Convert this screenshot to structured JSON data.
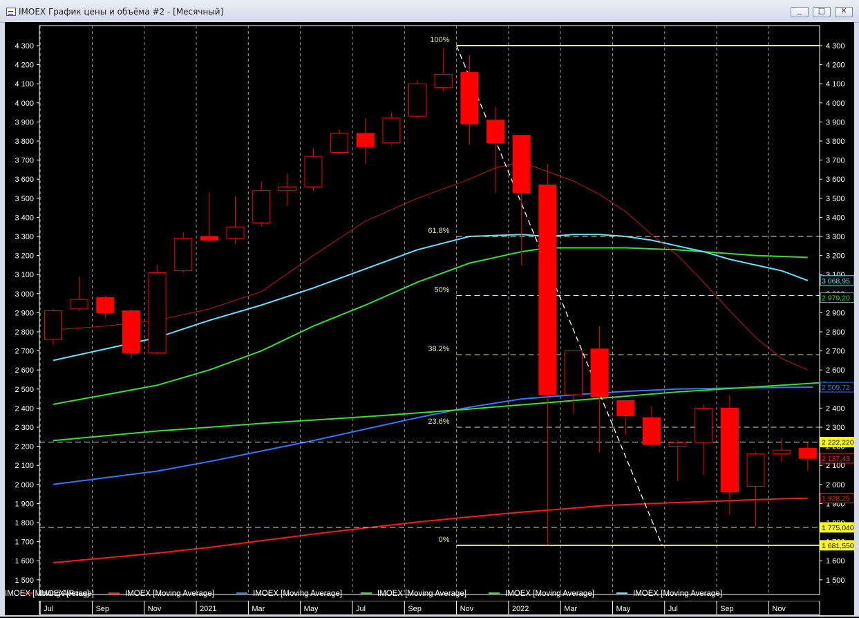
{
  "window": {
    "title": "IMOEX График цены и объёма #2 - [Месячный]",
    "minimize_glyph": "_",
    "maximize_glyph": "□",
    "close_glyph": "✕",
    "icon": "chart-window-icon"
  },
  "chart_data": {
    "type": "candlestick",
    "title": "",
    "xlabel": "",
    "ylabel": "",
    "ylim": [
      1480,
      4380
    ],
    "y_ticks": [
      1500,
      1600,
      1700,
      1800,
      1900,
      2000,
      2100,
      2200,
      2300,
      2400,
      2500,
      2600,
      2700,
      2800,
      2900,
      3000,
      3100,
      3200,
      3300,
      3400,
      3500,
      3600,
      3700,
      3800,
      3900,
      4000,
      4100,
      4200,
      4300
    ],
    "y_tick_labels": [
      "1 500",
      "1 600",
      "1 700",
      "1 800",
      "1 900",
      "2 000",
      "2 100",
      "2 200",
      "2 300",
      "2 400",
      "2 500",
      "2 600",
      "2 700",
      "2 800",
      "2 900",
      "3 000",
      "3 100",
      "3 200",
      "3 300",
      "3 400",
      "3 500",
      "3 600",
      "3 700",
      "3 800",
      "3 900",
      "4 000",
      "4 100",
      "4 200",
      "4 300"
    ],
    "x_labels": [
      "Jul",
      "Sep",
      "Nov",
      "2021",
      "Mar",
      "May",
      "Jul",
      "Sep",
      "Nov",
      "2022",
      "Mar",
      "May",
      "Jul",
      "Sep",
      "Nov"
    ],
    "x_label_months": [
      1,
      3,
      5,
      7,
      9,
      11,
      13,
      15,
      17,
      19,
      21,
      23,
      25,
      27,
      29
    ],
    "grid": true,
    "colors": {
      "up": "#ff0000",
      "down": "#ff0000",
      "grid": "#9a9a9a",
      "axis_text": "#ffffff",
      "fib": "#e8e8a8"
    },
    "candles": [
      {
        "m": 0,
        "o": 2760,
        "h": 2920,
        "l": 2730,
        "c": 2910
      },
      {
        "m": 1,
        "o": 2920,
        "h": 3090,
        "l": 2910,
        "c": 2970
      },
      {
        "m": 2,
        "o": 2980,
        "h": 2990,
        "l": 2870,
        "c": 2900
      },
      {
        "m": 3,
        "o": 2910,
        "h": 2920,
        "l": 2660,
        "c": 2690
      },
      {
        "m": 4,
        "o": 2690,
        "h": 3150,
        "l": 2680,
        "c": 3110
      },
      {
        "m": 5,
        "o": 3120,
        "h": 3320,
        "l": 3110,
        "c": 3290
      },
      {
        "m": 6,
        "o": 3300,
        "h": 3530,
        "l": 3270,
        "c": 3280
      },
      {
        "m": 7,
        "o": 3290,
        "h": 3510,
        "l": 3260,
        "c": 3350
      },
      {
        "m": 8,
        "o": 3370,
        "h": 3590,
        "l": 3350,
        "c": 3540
      },
      {
        "m": 9,
        "o": 3540,
        "h": 3630,
        "l": 3460,
        "c": 3560
      },
      {
        "m": 10,
        "o": 3560,
        "h": 3760,
        "l": 3540,
        "c": 3720
      },
      {
        "m": 11,
        "o": 3740,
        "h": 3860,
        "l": 3730,
        "c": 3840
      },
      {
        "m": 12,
        "o": 3840,
        "h": 3920,
        "l": 3680,
        "c": 3770
      },
      {
        "m": 13,
        "o": 3790,
        "h": 3950,
        "l": 3780,
        "c": 3920
      },
      {
        "m": 14,
        "o": 3930,
        "h": 4120,
        "l": 3920,
        "c": 4100
      },
      {
        "m": 15,
        "o": 4080,
        "h": 4290,
        "l": 4060,
        "c": 4150
      },
      {
        "m": 16,
        "o": 4160,
        "h": 4250,
        "l": 3780,
        "c": 3890
      },
      {
        "m": 17,
        "o": 3910,
        "h": 3980,
        "l": 3530,
        "c": 3790
      },
      {
        "m": 18,
        "o": 3830,
        "h": 3830,
        "l": 3150,
        "c": 3530
      },
      {
        "m": 19,
        "o": 3570,
        "h": 3680,
        "l": 1681,
        "c": 2470
      },
      {
        "m": 20,
        "o": 2470,
        "h": 2700,
        "l": 2370,
        "c": 2700
      },
      {
        "m": 21,
        "o": 2710,
        "h": 2830,
        "l": 2170,
        "c": 2460
      },
      {
        "m": 22,
        "o": 2440,
        "h": 2440,
        "l": 2260,
        "c": 2360
      },
      {
        "m": 23,
        "o": 2350,
        "h": 2410,
        "l": 2190,
        "c": 2210
      },
      {
        "m": 24,
        "o": 2200,
        "h": 2230,
        "l": 2020,
        "c": 2220
      },
      {
        "m": 25,
        "o": 2220,
        "h": 2420,
        "l": 2050,
        "c": 2400
      },
      {
        "m": 26,
        "o": 2400,
        "h": 2470,
        "l": 1840,
        "c": 1960
      },
      {
        "m": 27,
        "o": 1990,
        "h": 2170,
        "l": 1780,
        "c": 2160
      },
      {
        "m": 28,
        "o": 2160,
        "h": 2240,
        "l": 2120,
        "c": 2180
      },
      {
        "m": 29,
        "o": 2190,
        "h": 2220,
        "l": 2070,
        "c": 2137
      }
    ],
    "series": [
      {
        "name": "IMOEX [Price]",
        "color": "#ff0000"
      },
      {
        "name": "IMOEX [Moving Average]",
        "color": "#ff1a1a",
        "x": [
          0,
          2,
          4,
          6,
          8,
          10,
          12,
          14,
          16,
          18,
          19.5,
          21,
          23,
          25,
          26,
          27,
          28,
          29
        ],
        "values": [
          1590,
          1615,
          1640,
          1670,
          1705,
          1740,
          1772,
          1803,
          1830,
          1855,
          1870,
          1888,
          1900,
          1910,
          1915,
          1920,
          1925,
          1928
        ]
      },
      {
        "name": "IMOEX [Moving Average]",
        "color": "#3377ff",
        "x": [
          0,
          2,
          4,
          6,
          8,
          10,
          12,
          14,
          16,
          18,
          20,
          22,
          24,
          26,
          28,
          29.2
        ],
        "values": [
          2000,
          2035,
          2070,
          2120,
          2175,
          2230,
          2290,
          2350,
          2405,
          2448,
          2470,
          2488,
          2500,
          2505,
          2509,
          2510
        ]
      },
      {
        "name": "IMOEX [Moving Average]",
        "color": "#33e033",
        "x": [
          0,
          4,
          8,
          12,
          16,
          20,
          24,
          28,
          29.7
        ],
        "values": [
          2230,
          2280,
          2320,
          2355,
          2395,
          2440,
          2485,
          2520,
          2535
        ]
      },
      {
        "name": "IMOEX [Moving Average]",
        "color": "#33e033",
        "x": [
          0,
          2,
          4,
          6,
          8,
          10,
          12,
          14,
          16,
          18,
          19,
          20,
          21,
          22,
          23,
          24,
          25,
          26,
          27,
          28,
          29
        ],
        "values": [
          2420,
          2470,
          2520,
          2600,
          2700,
          2830,
          2940,
          3060,
          3160,
          3220,
          3240,
          3240,
          3240,
          3240,
          3235,
          3230,
          3220,
          3210,
          3200,
          3195,
          3190
        ]
      },
      {
        "name": "IMOEX [Moving Average]",
        "color": "#66e0ff",
        "x": [
          0,
          2,
          4,
          6,
          8,
          10,
          12,
          14,
          16,
          18,
          19,
          20,
          21,
          22,
          23,
          24,
          25,
          26,
          27,
          28,
          29
        ],
        "values": [
          2650,
          2710,
          2770,
          2860,
          2940,
          3030,
          3130,
          3230,
          3300,
          3310,
          3300,
          3310,
          3310,
          3300,
          3280,
          3250,
          3220,
          3180,
          3150,
          3120,
          3069
        ]
      },
      {
        "name": "IMOEX [Moving Average]",
        "color": "#c01818",
        "x": [
          0,
          2,
          4,
          6,
          8,
          10,
          12,
          14,
          16,
          17,
          18,
          19,
          20,
          21,
          22,
          23,
          24,
          25,
          26,
          27,
          28,
          29
        ],
        "values": [
          2810,
          2830,
          2860,
          2920,
          3010,
          3200,
          3380,
          3500,
          3600,
          3660,
          3690,
          3640,
          3590,
          3520,
          3430,
          3310,
          3200,
          3060,
          2910,
          2770,
          2660,
          2600
        ]
      }
    ],
    "fibonacci": {
      "levels": [
        {
          "label": "100%",
          "value": 4300
        },
        {
          "label": "61.8%",
          "value": 3300
        },
        {
          "label": "50%",
          "value": 2990
        },
        {
          "label": "38.2%",
          "value": 2680
        },
        {
          "label": "23.6%",
          "value": 2300
        },
        {
          "label": "0%",
          "value": 1681
        }
      ],
      "start_month": 15.5,
      "trend_from": [
        15.5,
        4300
      ],
      "trend_to": [
        23.4,
        1681
      ]
    },
    "dashed_levels": [
      {
        "value": 2222,
        "color": "#e8e8a8",
        "start_month": -1.5
      },
      {
        "value": 1775,
        "color": "#e8e8a8",
        "start_month": -1.5
      }
    ],
    "solid_levels": [
      {
        "value": 4300,
        "color": "#e8e8a0",
        "start_month": 15.5
      },
      {
        "value": 1681,
        "color": "#e8e8a0",
        "start_month": 15.5
      }
    ],
    "right_labels": [
      {
        "text": "3 068,95",
        "value": 3069,
        "bg": "#000000",
        "fg": "#66e0ff",
        "border": "#66e0ff"
      },
      {
        "text": "2 979,20",
        "value": 2979,
        "bg": "#000000",
        "fg": "#33e033",
        "border": "#33e033"
      },
      {
        "text": "2 509,72",
        "value": 2510,
        "bg": "#000000",
        "fg": "#3377ff",
        "border": "#3377ff"
      },
      {
        "text": "2 222,220",
        "value": 2222,
        "bg": "#ffff00",
        "fg": "#000000",
        "border": "#ffff00"
      },
      {
        "text": "2 137,43",
        "value": 2137,
        "bg": "#000000",
        "fg": "#ff2020",
        "border": "#ff2020"
      },
      {
        "text": "1 928,25",
        "value": 1928,
        "bg": "#000000",
        "fg": "#ff2020",
        "border": "#ff2020"
      },
      {
        "text": "1 775,040",
        "value": 1775,
        "bg": "#ffff00",
        "fg": "#000000",
        "border": "#ffff00"
      },
      {
        "text": "1 681,550",
        "value": 1681,
        "bg": "#ffff00",
        "fg": "#000000",
        "border": "#ffff00"
      }
    ]
  }
}
